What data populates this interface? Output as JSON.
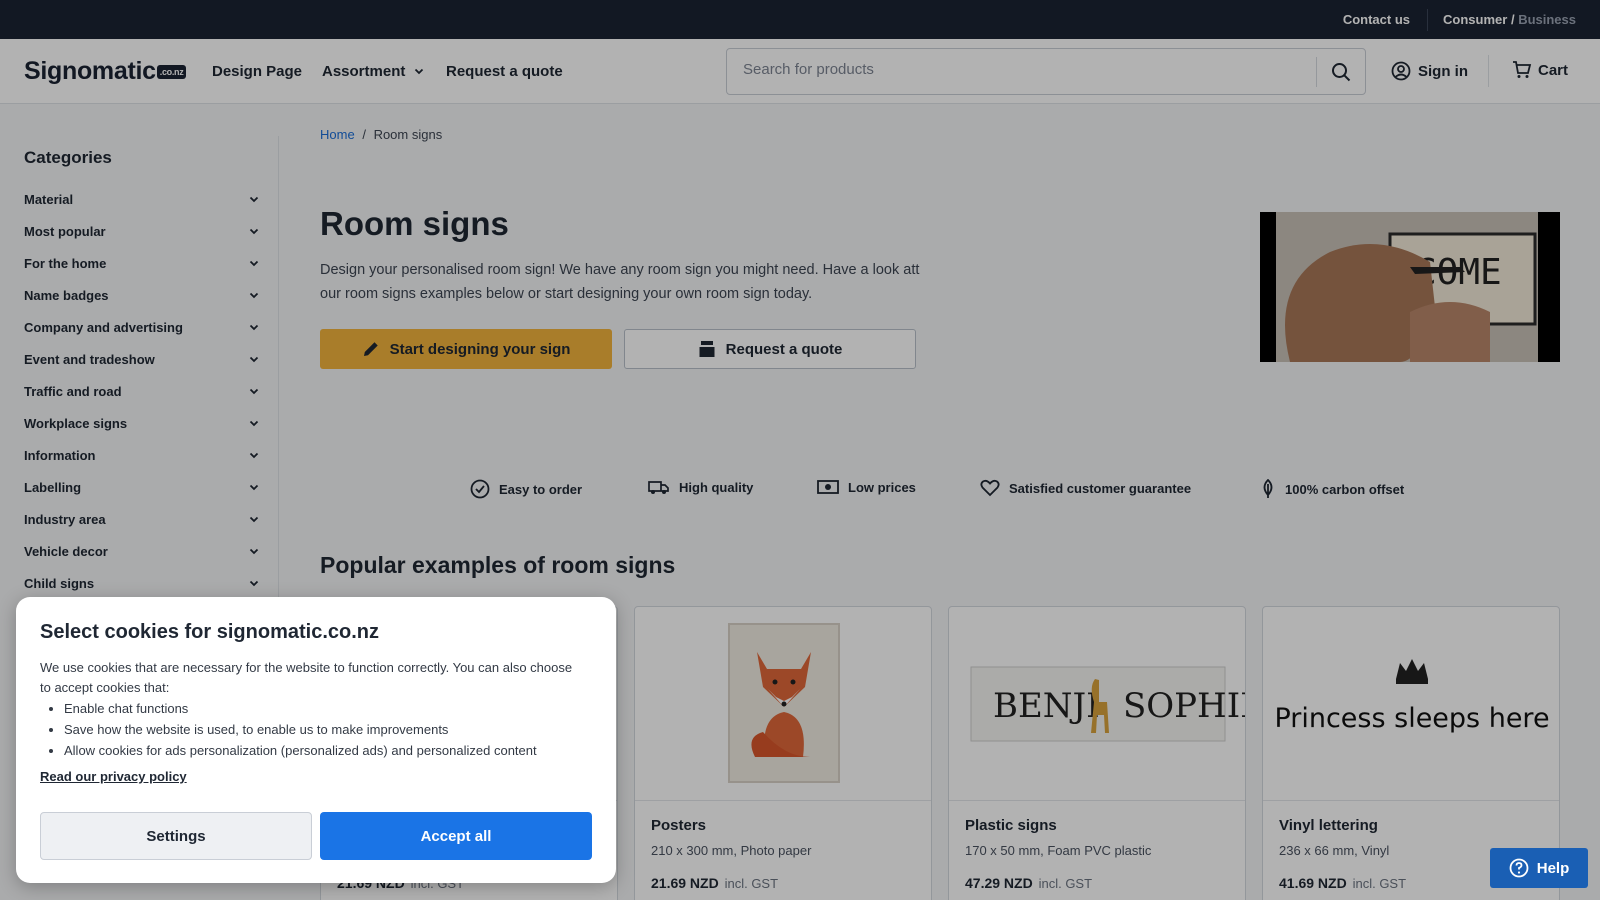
{
  "topbar": {
    "contact": "Contact us",
    "consumer": "Consumer",
    "slash": "/",
    "business": "Business"
  },
  "header": {
    "logo": "Signomatic",
    "logo_tld": ".co.nz",
    "nav": [
      "Design Page",
      "Assortment",
      "Request a quote"
    ],
    "search_placeholder": "Search for products",
    "signin": "Sign in",
    "cart": "Cart"
  },
  "sidebar": {
    "title": "Categories",
    "items": [
      "Material",
      "Most popular",
      "For the home",
      "Name badges",
      "Company and advertising",
      "Event and tradeshow",
      "Traffic and road",
      "Workplace signs",
      "Information",
      "Labelling",
      "Industry area",
      "Vehicle decor",
      "Child signs"
    ]
  },
  "breadcrumb": {
    "home": "Home",
    "sep": "/",
    "current": "Room signs"
  },
  "hero": {
    "title": "Room signs",
    "description": "Design your personalised room sign! We have any room sign you might need. Have a look att our room signs examples below or start designing your own room sign today.",
    "design_button": "Start designing your sign",
    "quote_button": "Request a quote",
    "video_text": "COME"
  },
  "usps": [
    "Easy to order",
    "High quality",
    "Low prices",
    "Satisfied customer guarantee",
    "100% carbon offset"
  ],
  "popular_title": "Popular examples of room signs",
  "products": [
    {
      "name": "",
      "spec": "",
      "price": "21.69 NZD",
      "gst": "incl. GST"
    },
    {
      "name": "Posters",
      "spec": "210 x 300 mm, Photo paper",
      "price": "21.69 NZD",
      "gst": "incl. GST"
    },
    {
      "name": "Plastic signs",
      "spec": "170 x 50 mm, Foam PVC plastic",
      "price": "47.29 NZD",
      "gst": "incl. GST",
      "sign_text_left": "BENJI",
      "sign_text_right": "SOPHIE"
    },
    {
      "name": "Vinyl lettering",
      "spec": "236 x 66 mm, Vinyl",
      "price": "41.69 NZD",
      "gst": "incl. GST",
      "sign_text": "Princess sleeps here"
    }
  ],
  "cookie": {
    "title": "Select cookies for signomatic.co.nz",
    "intro": "We use cookies that are necessary for the website to function correctly. You can also choose to accept cookies that:",
    "bullets": [
      "Enable chat functions",
      "Save how the website is used, to enable us to make improvements",
      "Allow cookies for ads personalization (personalized ads) and personalized content"
    ],
    "policy_link": "Read our privacy policy",
    "settings_button": "Settings",
    "accept_button": "Accept all"
  },
  "help": {
    "label": "Help"
  },
  "colors": {
    "topbar": "#1b2333",
    "accent_yellow": "#f2b33d",
    "primary_blue": "#1a74e6",
    "help_blue": "#1a5fb4",
    "link_blue": "#1a6ed8"
  }
}
